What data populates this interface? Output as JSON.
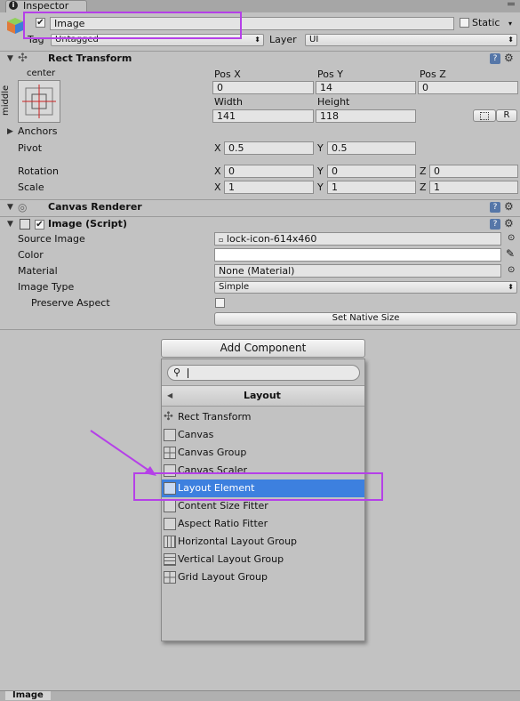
{
  "window": {
    "tab_title": "Inspector"
  },
  "object": {
    "name": "Image",
    "static_label": "Static",
    "tag_label": "Tag",
    "tag_value": "Untagged",
    "layer_label": "Layer",
    "layer_value": "UI"
  },
  "rect_transform": {
    "title": "Rect Transform",
    "anchor_top": "center",
    "anchor_side": "middle",
    "pos_x_label": "Pos X",
    "pos_y_label": "Pos Y",
    "pos_z_label": "Pos Z",
    "pos_x": "0",
    "pos_y": "14",
    "pos_z": "0",
    "width_label": "Width",
    "height_label": "Height",
    "width": "141",
    "height": "118",
    "r_button": "R",
    "anchors_label": "Anchors",
    "pivot_label": "Pivot",
    "pivot_x": "0.5",
    "pivot_y": "0.5",
    "rotation_label": "Rotation",
    "rot_x": "0",
    "rot_y": "0",
    "rot_z": "0",
    "scale_label": "Scale",
    "scale_x": "1",
    "scale_y": "1",
    "scale_z": "1",
    "x": "X",
    "y": "Y",
    "z": "Z"
  },
  "canvas_renderer": {
    "title": "Canvas Renderer"
  },
  "image_script": {
    "title": "Image (Script)",
    "source_image_label": "Source Image",
    "source_image_value": "lock-icon-614x460",
    "color_label": "Color",
    "material_label": "Material",
    "material_value": "None (Material)",
    "image_type_label": "Image Type",
    "image_type_value": "Simple",
    "preserve_aspect_label": "Preserve Aspect",
    "set_native_size": "Set Native Size"
  },
  "add_component": {
    "button": "Add Component",
    "search_placeholder": "",
    "category_title": "Layout",
    "items": [
      "Rect Transform",
      "Canvas",
      "Canvas Group",
      "Canvas Scaler",
      "Layout Element",
      "Content Size Fitter",
      "Aspect Ratio Fitter",
      "Horizontal Layout Group",
      "Vertical Layout Group",
      "Grid Layout Group"
    ],
    "selected_index": 4
  },
  "footer": {
    "label": "Image"
  },
  "colors": {
    "panel": "#c2c2c2",
    "selection": "#3d80df",
    "annotation": "#b540e8",
    "help": "#5677a8"
  },
  "icons": [
    "cube-icon",
    "gear-icon",
    "help-icon",
    "search-icon",
    "back-arrow-icon",
    "eyedropper-icon",
    "object-picker-icon"
  ]
}
